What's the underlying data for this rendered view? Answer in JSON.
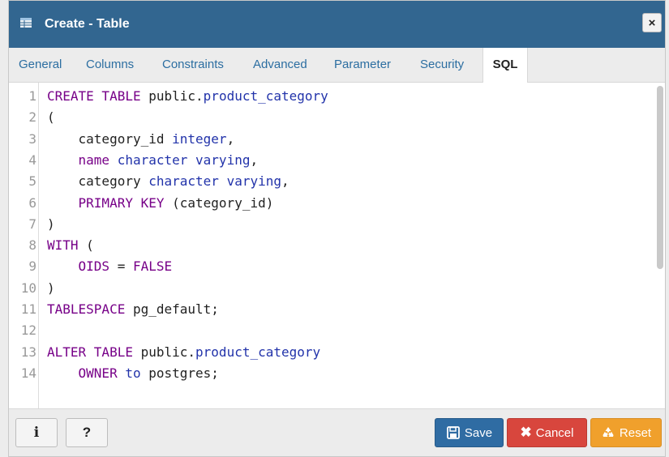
{
  "dialog": {
    "title": "Create - Table",
    "close_glyph": "×",
    "title_icon": "table-icon"
  },
  "tabs": [
    {
      "label": "General"
    },
    {
      "label": "Columns"
    },
    {
      "label": "Constraints"
    },
    {
      "label": "Advanced"
    },
    {
      "label": "Parameter"
    },
    {
      "label": "Security"
    },
    {
      "label": "SQL",
      "active": true
    }
  ],
  "editor": {
    "lines": [
      {
        "n": "1",
        "tokens": [
          {
            "t": "CREATE TABLE ",
            "c": "kw"
          },
          {
            "t": "public.",
            "c": "id"
          },
          {
            "t": "product_category",
            "c": "ty"
          }
        ]
      },
      {
        "n": "2",
        "tokens": [
          {
            "t": "(",
            "c": "id"
          }
        ]
      },
      {
        "n": "3",
        "tokens": [
          {
            "t": "    category_id ",
            "c": "id"
          },
          {
            "t": "integer",
            "c": "ty"
          },
          {
            "t": ",",
            "c": "id"
          }
        ]
      },
      {
        "n": "4",
        "tokens": [
          {
            "t": "    name ",
            "c": "kw"
          },
          {
            "t": "character varying",
            "c": "ty"
          },
          {
            "t": ",",
            "c": "id"
          }
        ]
      },
      {
        "n": "5",
        "tokens": [
          {
            "t": "    category ",
            "c": "id"
          },
          {
            "t": "character varying",
            "c": "ty"
          },
          {
            "t": ",",
            "c": "id"
          }
        ]
      },
      {
        "n": "6",
        "tokens": [
          {
            "t": "    PRIMARY KEY ",
            "c": "kw"
          },
          {
            "t": "(category_id)",
            "c": "id"
          }
        ]
      },
      {
        "n": "7",
        "tokens": [
          {
            "t": ")",
            "c": "id"
          }
        ]
      },
      {
        "n": "8",
        "tokens": [
          {
            "t": "WITH ",
            "c": "kw"
          },
          {
            "t": "(",
            "c": "id"
          }
        ]
      },
      {
        "n": "9",
        "tokens": [
          {
            "t": "    OIDS ",
            "c": "kw"
          },
          {
            "t": "= ",
            "c": "id"
          },
          {
            "t": "FALSE",
            "c": "kw"
          }
        ]
      },
      {
        "n": "10",
        "tokens": [
          {
            "t": ")",
            "c": "id"
          }
        ]
      },
      {
        "n": "11",
        "tokens": [
          {
            "t": "TABLESPACE ",
            "c": "kw"
          },
          {
            "t": "pg_default;",
            "c": "id"
          }
        ]
      },
      {
        "n": "12",
        "tokens": []
      },
      {
        "n": "13",
        "tokens": [
          {
            "t": "ALTER TABLE ",
            "c": "kw"
          },
          {
            "t": "public.",
            "c": "id"
          },
          {
            "t": "product_category",
            "c": "ty"
          }
        ]
      },
      {
        "n": "14",
        "tokens": [
          {
            "t": "    OWNER ",
            "c": "kw"
          },
          {
            "t": "to ",
            "c": "ty"
          },
          {
            "t": "postgres;",
            "c": "id"
          }
        ]
      }
    ]
  },
  "footer": {
    "info_label": "i",
    "help_label": "?",
    "save_label": "Save",
    "cancel_label": "Cancel",
    "reset_label": "Reset"
  },
  "colors": {
    "titlebar": "#326690",
    "save": "#2f6ca3",
    "cancel": "#d8463d",
    "reset": "#f0a02c",
    "tab_link": "#2c6ea1"
  }
}
